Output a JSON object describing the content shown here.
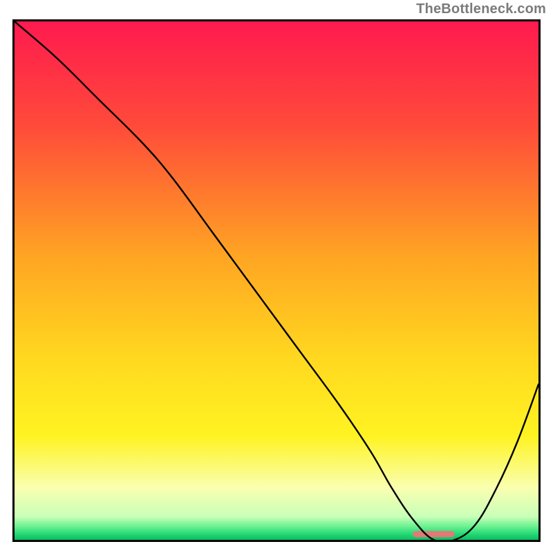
{
  "attribution": "TheBottleneck.com",
  "chart_data": {
    "type": "line",
    "title": "",
    "xlabel": "",
    "ylabel": "",
    "xlim": [
      0,
      100
    ],
    "ylim": [
      0,
      100
    ],
    "gradient_stops": [
      {
        "offset": 0.0,
        "color": "#ff1a4f"
      },
      {
        "offset": 0.2,
        "color": "#ff4a3a"
      },
      {
        "offset": 0.45,
        "color": "#ffa423"
      },
      {
        "offset": 0.65,
        "color": "#ffd81f"
      },
      {
        "offset": 0.8,
        "color": "#fff322"
      },
      {
        "offset": 0.9,
        "color": "#f9ffb0"
      },
      {
        "offset": 0.955,
        "color": "#c9ffb8"
      },
      {
        "offset": 0.975,
        "color": "#66f08e"
      },
      {
        "offset": 0.99,
        "color": "#1fd673"
      },
      {
        "offset": 1.0,
        "color": "#0dbb5e"
      }
    ],
    "series": [
      {
        "name": "curve",
        "x": [
          0,
          8,
          16,
          24,
          30,
          38,
          46,
          54,
          62,
          68,
          72,
          76,
          80,
          84,
          88,
          92,
          96,
          100
        ],
        "y": [
          100,
          93,
          85,
          77,
          70,
          59,
          48,
          37,
          26,
          17,
          10,
          4,
          0,
          0,
          3,
          10,
          19,
          30
        ]
      }
    ],
    "marker": {
      "name": "optimal-zone",
      "x_start": 76,
      "x_end": 84,
      "y": 1.1,
      "color": "#e17a77",
      "thickness_pct": 1.2
    }
  }
}
